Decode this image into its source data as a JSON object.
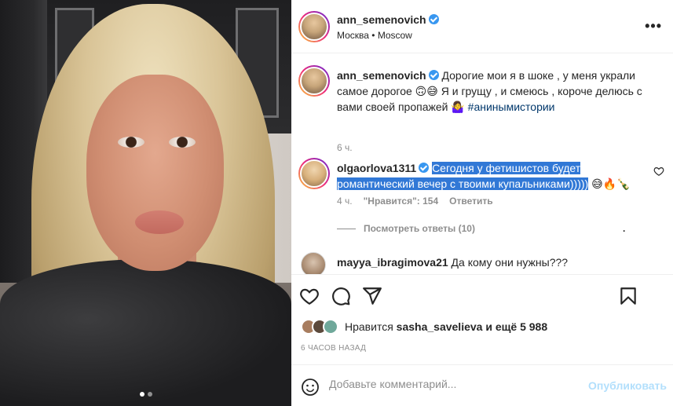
{
  "post": {
    "author": "ann_semenovich",
    "location": "Москва • Moscow",
    "more_label": "•••",
    "caption_text": "Дорогие мои я в шоке , у меня украли самое дорогое 🙃😅 Я и грущу , и смеюсь , короче делюсь с вами своей пропажей 🤷‍♀️",
    "caption_hashtag": "#анинымистории",
    "caption_time": "6 ч."
  },
  "comments": [
    {
      "username": "olgaorlova1311",
      "text_highlighted": "Сегодня у фетишистов будет романтический вечер с твоими купальниками)))))",
      "text_after": " 😅🔥🍾",
      "time": "4 ч.",
      "likes": "\"Нравится\": 154",
      "reply_label": "Ответить",
      "view_replies": "Посмотреть ответы (10)",
      "trailing_dot": "."
    },
    {
      "username": "mayya_ibragimova21",
      "text": "Да кому они нужны???"
    }
  ],
  "likes_summary": {
    "prefix": "Нравится",
    "user": "sasha_savelieva",
    "suffix": "и ещё 5 988"
  },
  "posted_ago": "6 ЧАСОВ НАЗАД",
  "add_comment": {
    "placeholder": "Добавьте комментарий...",
    "post_label": "Опубликовать"
  },
  "carousel": {
    "count": 2,
    "active": 0
  },
  "icons": [
    "heart-icon",
    "comment-icon",
    "share-icon",
    "bookmark-icon",
    "emoji-icon",
    "more-icon",
    "verified-icon"
  ],
  "colors": {
    "verified": "#3897f0",
    "highlight": "#3178d6",
    "hashtag": "#00376b",
    "post_disabled": "#b2dffc",
    "muted": "#8e8e8e"
  }
}
